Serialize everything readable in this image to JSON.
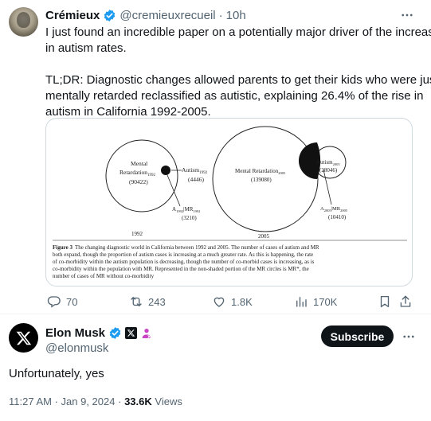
{
  "original_tweet": {
    "author_name": "Crémieux",
    "author_handle": "@cremieuxrecueil",
    "separator": "·",
    "time": "10h",
    "line1": "I just found an incredible paper on a potentially major driver of the increase",
    "line2": "in autism rates.",
    "line3": "TL;DR: Diagnostic changes allowed parents to get their kids who were just",
    "line4": "mentally retarded reclassified as autistic, explaining 26.4% of the rise in",
    "line5": "autism in California 1992-2005.",
    "figure": {
      "left": {
        "mr_label": "Mental",
        "mr_label2": "Retardation",
        "mr_sub": "1992",
        "mr_value": "(90422)",
        "autism_label": "Autism",
        "autism_sub": "1992",
        "autism_value": "(4446)",
        "overlap_label_a": "A",
        "overlap_sub1": "1992",
        "overlap_mid": "|MR",
        "overlap_sub2": "1992",
        "overlap_value": "(3210)",
        "year": "1992"
      },
      "right": {
        "mr_label": "Mental Retardation",
        "mr_sub": "2005",
        "mr_value": "(139080)",
        "autism_label": "Autism",
        "autism_sub": "2005",
        "autism_value": "(28046)",
        "overlap_label_a": "A",
        "overlap_sub1": "2005",
        "overlap_mid": "|MR",
        "overlap_sub2": "2005",
        "overlap_value": "(10410)",
        "year": "2005"
      },
      "caption_bold": "Figure 3",
      "caption_line1": "The changing diagnostic world in California between 1992 and 2005. The number of cases of autism and MR",
      "caption_line2": "both expand, though the proportion of autism cases is increasing at a much greater rate. As this is happening, the rate",
      "caption_line3": "of co-morbidity within the autism population is decreasing, though the number of co-morbid cases is increasing, as is",
      "caption_line4": "co-morbidity within the population with MR. Represented in the non-shaded portion of the MR circles is MR*, the",
      "caption_line5": "number of cases of MR without co-morbidity"
    },
    "actions": {
      "replies": "70",
      "reposts": "243",
      "likes": "1.8K",
      "views": "170K"
    }
  },
  "reply_tweet": {
    "author_name": "Elon Musk",
    "author_handle": "@elonmusk",
    "subscribe_label": "Subscribe",
    "text": "Unfortunately, yes",
    "time": "11:27 AM · Jan 9, 2024",
    "separator": "·",
    "views_count": "33.6K",
    "views_label": "Views"
  },
  "colors": {
    "verified_blue": "#1d9bf0",
    "text": "#0f1419",
    "secondary": "#536471",
    "accent_pink": "#c944c4"
  }
}
